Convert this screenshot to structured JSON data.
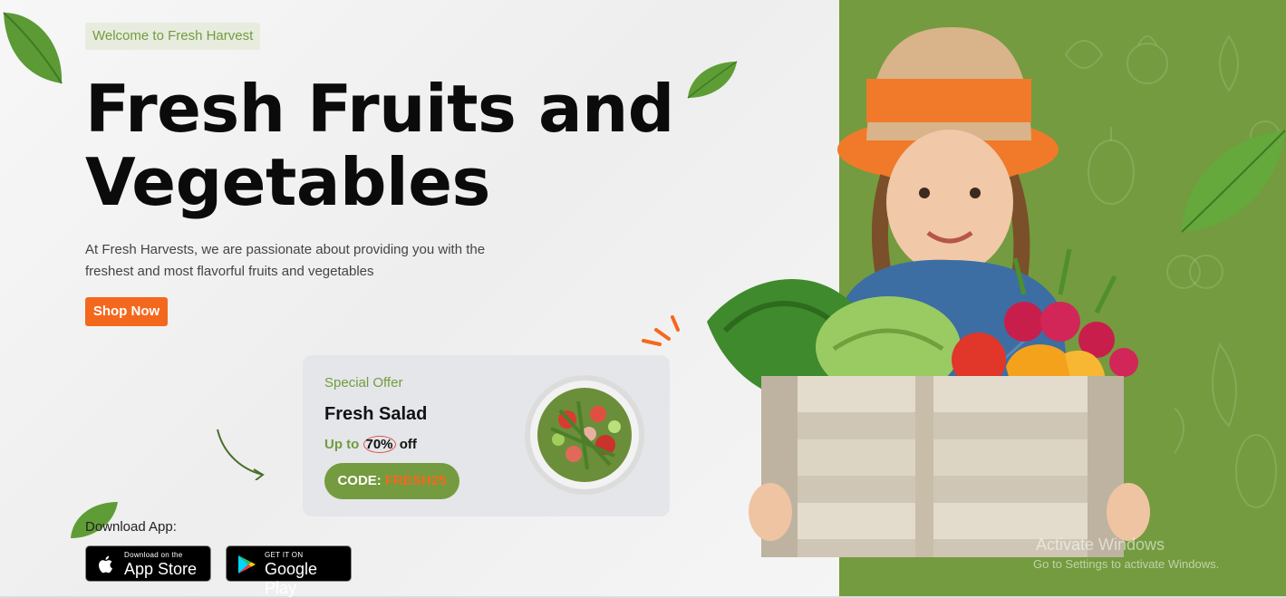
{
  "hero": {
    "welcome_tag": "Welcome to Fresh Harvest",
    "title_line1": "Fresh Fruits and",
    "title_line2": "Vegetables",
    "description": "At Fresh Harvests, we are passionate about providing you with the freshest and most flavorful fruits and vegetables",
    "cta_label": "Shop Now"
  },
  "offer": {
    "label": "Special Offer",
    "name": "Fresh Salad",
    "discount_prefix": "Up to",
    "discount_value": "70%",
    "discount_suffix": "off",
    "code_label": "CODE:",
    "code_value": "FRESH25"
  },
  "download": {
    "label": "Download App:",
    "app_store_small": "Download on the",
    "app_store_big": "App Store",
    "play_store_small": "GET IT ON",
    "play_store_big": "Google Play"
  },
  "watermark": {
    "line1": "Activate Windows",
    "line2": "Go to Settings to activate Windows."
  },
  "colors": {
    "accent_green": "#749b3f",
    "accent_orange": "#f4681e",
    "card_bg": "#e4e6e9"
  }
}
